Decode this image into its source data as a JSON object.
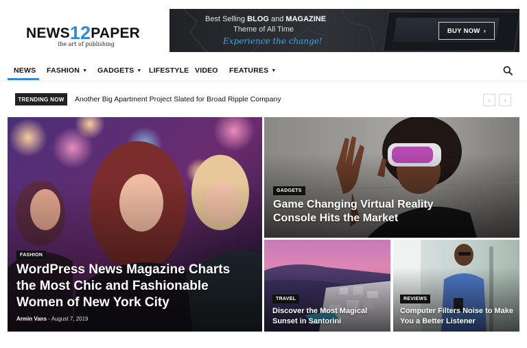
{
  "header": {
    "logo_prefix": "NEWS",
    "logo_number": "12",
    "logo_suffix": "PAPER",
    "tagline": "the art of publishing"
  },
  "banner": {
    "line1_prefix": "Best Selling ",
    "line1_blog": "BLOG",
    "line1_and": " and ",
    "line1_magazine": "MAGAZINE",
    "line2": "Theme of All Time",
    "line3": "Experience the change!",
    "button_label": "BUY NOW"
  },
  "nav": {
    "items": [
      {
        "label": "NEWS",
        "has_dropdown": false,
        "active": true
      },
      {
        "label": "FASHION",
        "has_dropdown": true
      },
      {
        "label": "GADGETS",
        "has_dropdown": true
      },
      {
        "label": "LIFESTYLE",
        "has_dropdown": false
      },
      {
        "label": "VIDEO",
        "has_dropdown": false
      },
      {
        "label": "FEATURES",
        "has_dropdown": true
      }
    ],
    "caret": "▼",
    "search_icon": "search-icon"
  },
  "trending": {
    "label": "TRENDING NOW",
    "headline": "Another Big Apartment Project Slated for Broad Ripple Company",
    "prev": "‹",
    "next": "›"
  },
  "posts": {
    "main": {
      "category": "FASHION",
      "title": "WordPress News Magazine Charts the Most Chic and Fashionable Women of New York City",
      "author": "Armin Vans",
      "date_sep": " - ",
      "date": "August 7, 2019"
    },
    "top_right": {
      "category": "GADGETS",
      "title": "Game Changing Virtual Reality Console Hits the Market"
    },
    "bottom_left": {
      "category": "TRAVEL",
      "title": "Discover the Most Magical Sunset in Santorini"
    },
    "bottom_right": {
      "category": "REVIEWS",
      "title": "Computer Filters Noise to Make You a Better Listener"
    }
  },
  "colors": {
    "accent": "#2e8ad8",
    "banner_link": "#38a9e6",
    "badge_bg": "#111111"
  }
}
